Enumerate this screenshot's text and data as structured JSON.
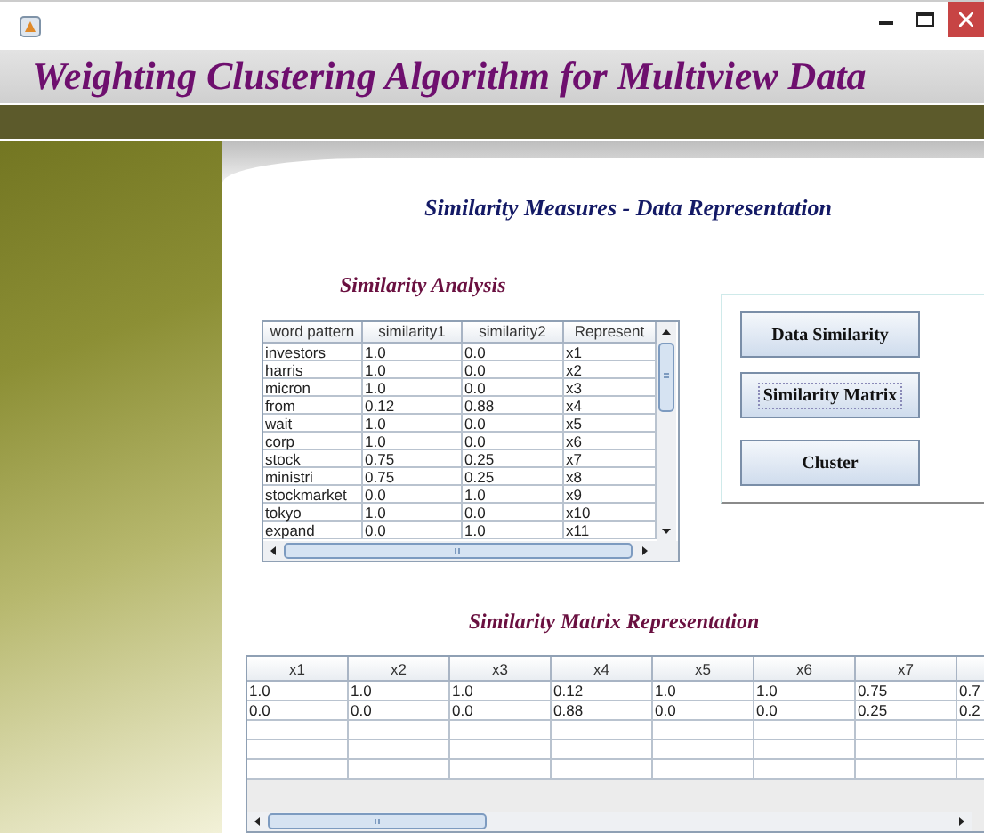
{
  "header": {
    "title": "Weighting Clustering Algorithm for Multiview Data"
  },
  "page_heading": "Similarity Measures - Data Representation",
  "similarity_analysis": {
    "title": "Similarity Analysis",
    "columns": [
      "word pattern",
      "similarity1",
      "similarity2",
      "Represent"
    ],
    "rows": [
      [
        "investors",
        "1.0",
        "0.0",
        "x1"
      ],
      [
        "harris",
        "1.0",
        "0.0",
        "x2"
      ],
      [
        "micron",
        "1.0",
        "0.0",
        "x3"
      ],
      [
        "from",
        "0.12",
        "0.88",
        "x4"
      ],
      [
        "wait",
        "1.0",
        "0.0",
        "x5"
      ],
      [
        "corp",
        "1.0",
        "0.0",
        "x6"
      ],
      [
        "stock",
        "0.75",
        "0.25",
        "x7"
      ],
      [
        "ministri",
        "0.75",
        "0.25",
        "x8"
      ],
      [
        "stockmarket",
        "0.0",
        "1.0",
        "x9"
      ],
      [
        "tokyo",
        "1.0",
        "0.0",
        "x10"
      ],
      [
        "expand",
        "0.0",
        "1.0",
        "x11"
      ]
    ]
  },
  "actions": [
    {
      "label": "Data Similarity",
      "focused": false
    },
    {
      "label": "Similarity Matrix",
      "focused": true
    },
    {
      "label": "Cluster",
      "focused": false
    }
  ],
  "matrix": {
    "title": "Similarity Matrix Representation",
    "columns": [
      "x1",
      "x2",
      "x3",
      "x4",
      "x5",
      "x6",
      "x7"
    ],
    "rows": [
      [
        "1.0",
        "1.0",
        "1.0",
        "0.12",
        "1.0",
        "1.0",
        "0.75",
        "0.7"
      ],
      [
        "0.0",
        "0.0",
        "0.0",
        "0.88",
        "0.0",
        "0.0",
        "0.25",
        "0.2"
      ]
    ]
  }
}
